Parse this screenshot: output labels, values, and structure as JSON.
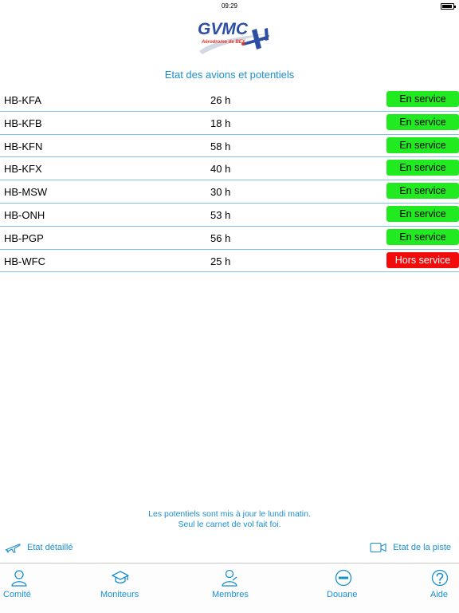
{
  "status_bar": {
    "time": "09:29",
    "battery_level": 0.9
  },
  "logo": {
    "text": "GVMC",
    "subtitle": "Aérodrome de BEX"
  },
  "page_title": "Etat des avions et potentiels",
  "aircraft": [
    {
      "registration": "HB-KFA",
      "hours": "26 h",
      "status": "En service",
      "status_color": "#21ea21"
    },
    {
      "registration": "HB-KFB",
      "hours": "18 h",
      "status": "En service",
      "status_color": "#21ea21"
    },
    {
      "registration": "HB-KFN",
      "hours": "58 h",
      "status": "En service",
      "status_color": "#21ea21"
    },
    {
      "registration": "HB-KFX",
      "hours": "40 h",
      "status": "En service",
      "status_color": "#21ea21"
    },
    {
      "registration": "HB-MSW",
      "hours": "30 h",
      "status": "En service",
      "status_color": "#21ea21"
    },
    {
      "registration": "HB-ONH",
      "hours": "53 h",
      "status": "En service",
      "status_color": "#21ea21"
    },
    {
      "registration": "HB-PGP",
      "hours": "56 h",
      "status": "En service",
      "status_color": "#21ea21"
    },
    {
      "registration": "HB-WFC",
      "hours": "25 h",
      "status": "Hors service",
      "status_color": "#f20b0b"
    }
  ],
  "footer_note": {
    "line1": "Les potentiels sont mis à jour le lundi matin.",
    "line2": "Seul le carnet de vol fait foi."
  },
  "links": {
    "detailed": {
      "label": "Etat détaillé",
      "icon": "airplane-icon"
    },
    "runway": {
      "label": "Etat de la piste",
      "icon": "video-camera-icon"
    }
  },
  "tabs": [
    {
      "label": "Comité",
      "icon": "person-icon"
    },
    {
      "label": "Moniteurs",
      "icon": "graduation-cap-icon"
    },
    {
      "label": "Membres",
      "icon": "person-wave-icon"
    },
    {
      "label": "Douane",
      "icon": "no-entry-icon"
    },
    {
      "label": "Aide",
      "icon": "help-icon"
    }
  ],
  "colors": {
    "accent": "#1a8fd0",
    "divider": "#7fc2e8",
    "in_service": "#21ea21",
    "out_of_service": "#f20b0b"
  }
}
